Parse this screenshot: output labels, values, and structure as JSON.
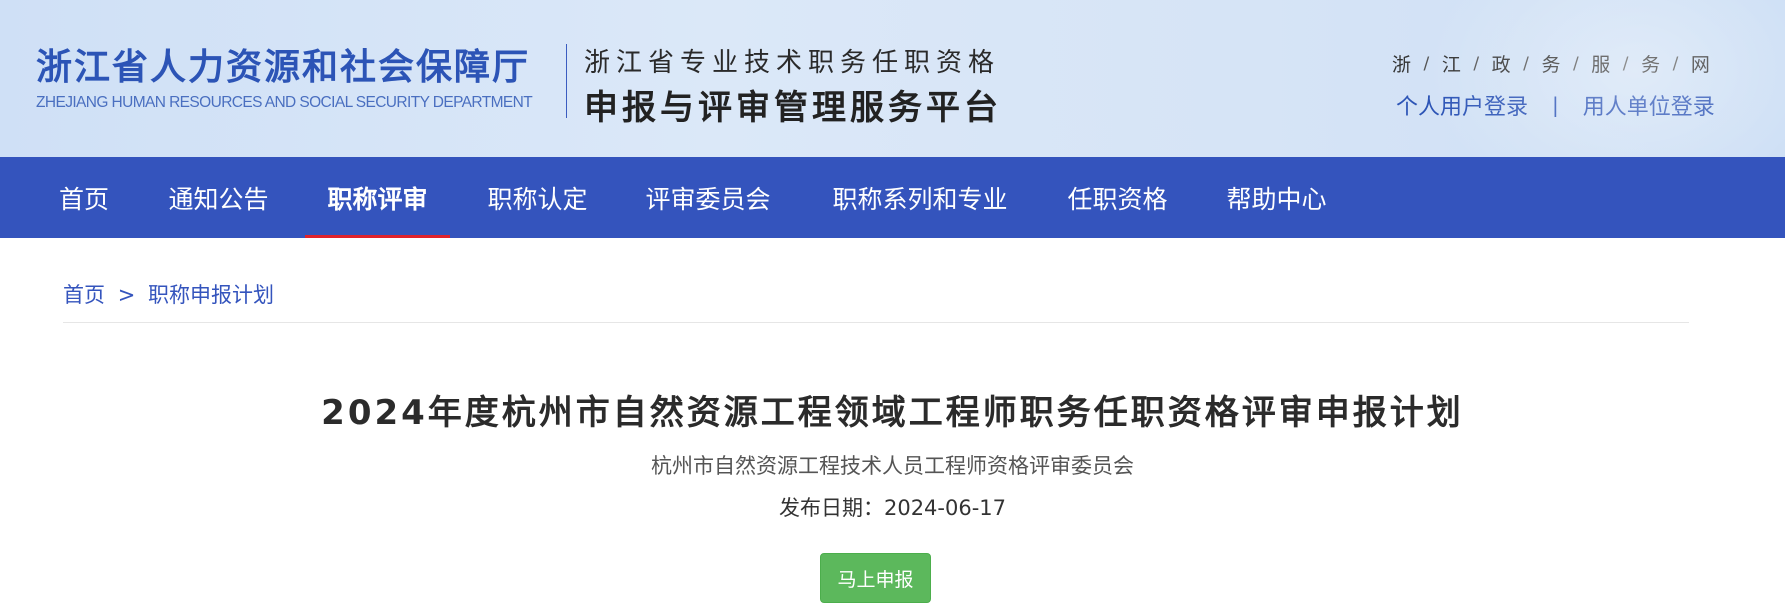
{
  "header": {
    "dept_name_cn": "浙江省人力资源和社会保障厅",
    "dept_name_en": "ZHEJIANG HUMAN RESOURCES AND SOCIAL SECURITY DEPARTMENT",
    "platform_subtitle": "浙江省专业技术职务任职资格",
    "platform_title": "申报与评审管理服务平台",
    "gov_link_chars": [
      "浙",
      "江",
      "政",
      "务",
      "服",
      "务",
      "网"
    ],
    "gov_link_separator": "/",
    "personal_login": "个人用户登录",
    "login_separator": "|",
    "employer_login": "用人单位登录"
  },
  "nav": {
    "items": [
      {
        "label": "首页"
      },
      {
        "label": "通知公告"
      },
      {
        "label": "职称评审"
      },
      {
        "label": "职称认定"
      },
      {
        "label": "评审委员会"
      },
      {
        "label": "职称系列和专业"
      },
      {
        "label": "任职资格"
      },
      {
        "label": "帮助中心"
      }
    ],
    "active": "职称评审"
  },
  "breadcrumb": {
    "home": "首页",
    "separator": ">",
    "current": "职称申报计划"
  },
  "article": {
    "title": "2024年度杭州市自然资源工程领域工程师职务任职资格评审申报计划",
    "publisher": "杭州市自然资源工程技术人员工程师资格评审委员会",
    "date": "发布日期：2024-06-17",
    "apply_button": "马上申报"
  },
  "colors": {
    "brand_blue": "#3454bd",
    "active_underline": "#e0222b",
    "apply_green": "#5cb85c"
  }
}
